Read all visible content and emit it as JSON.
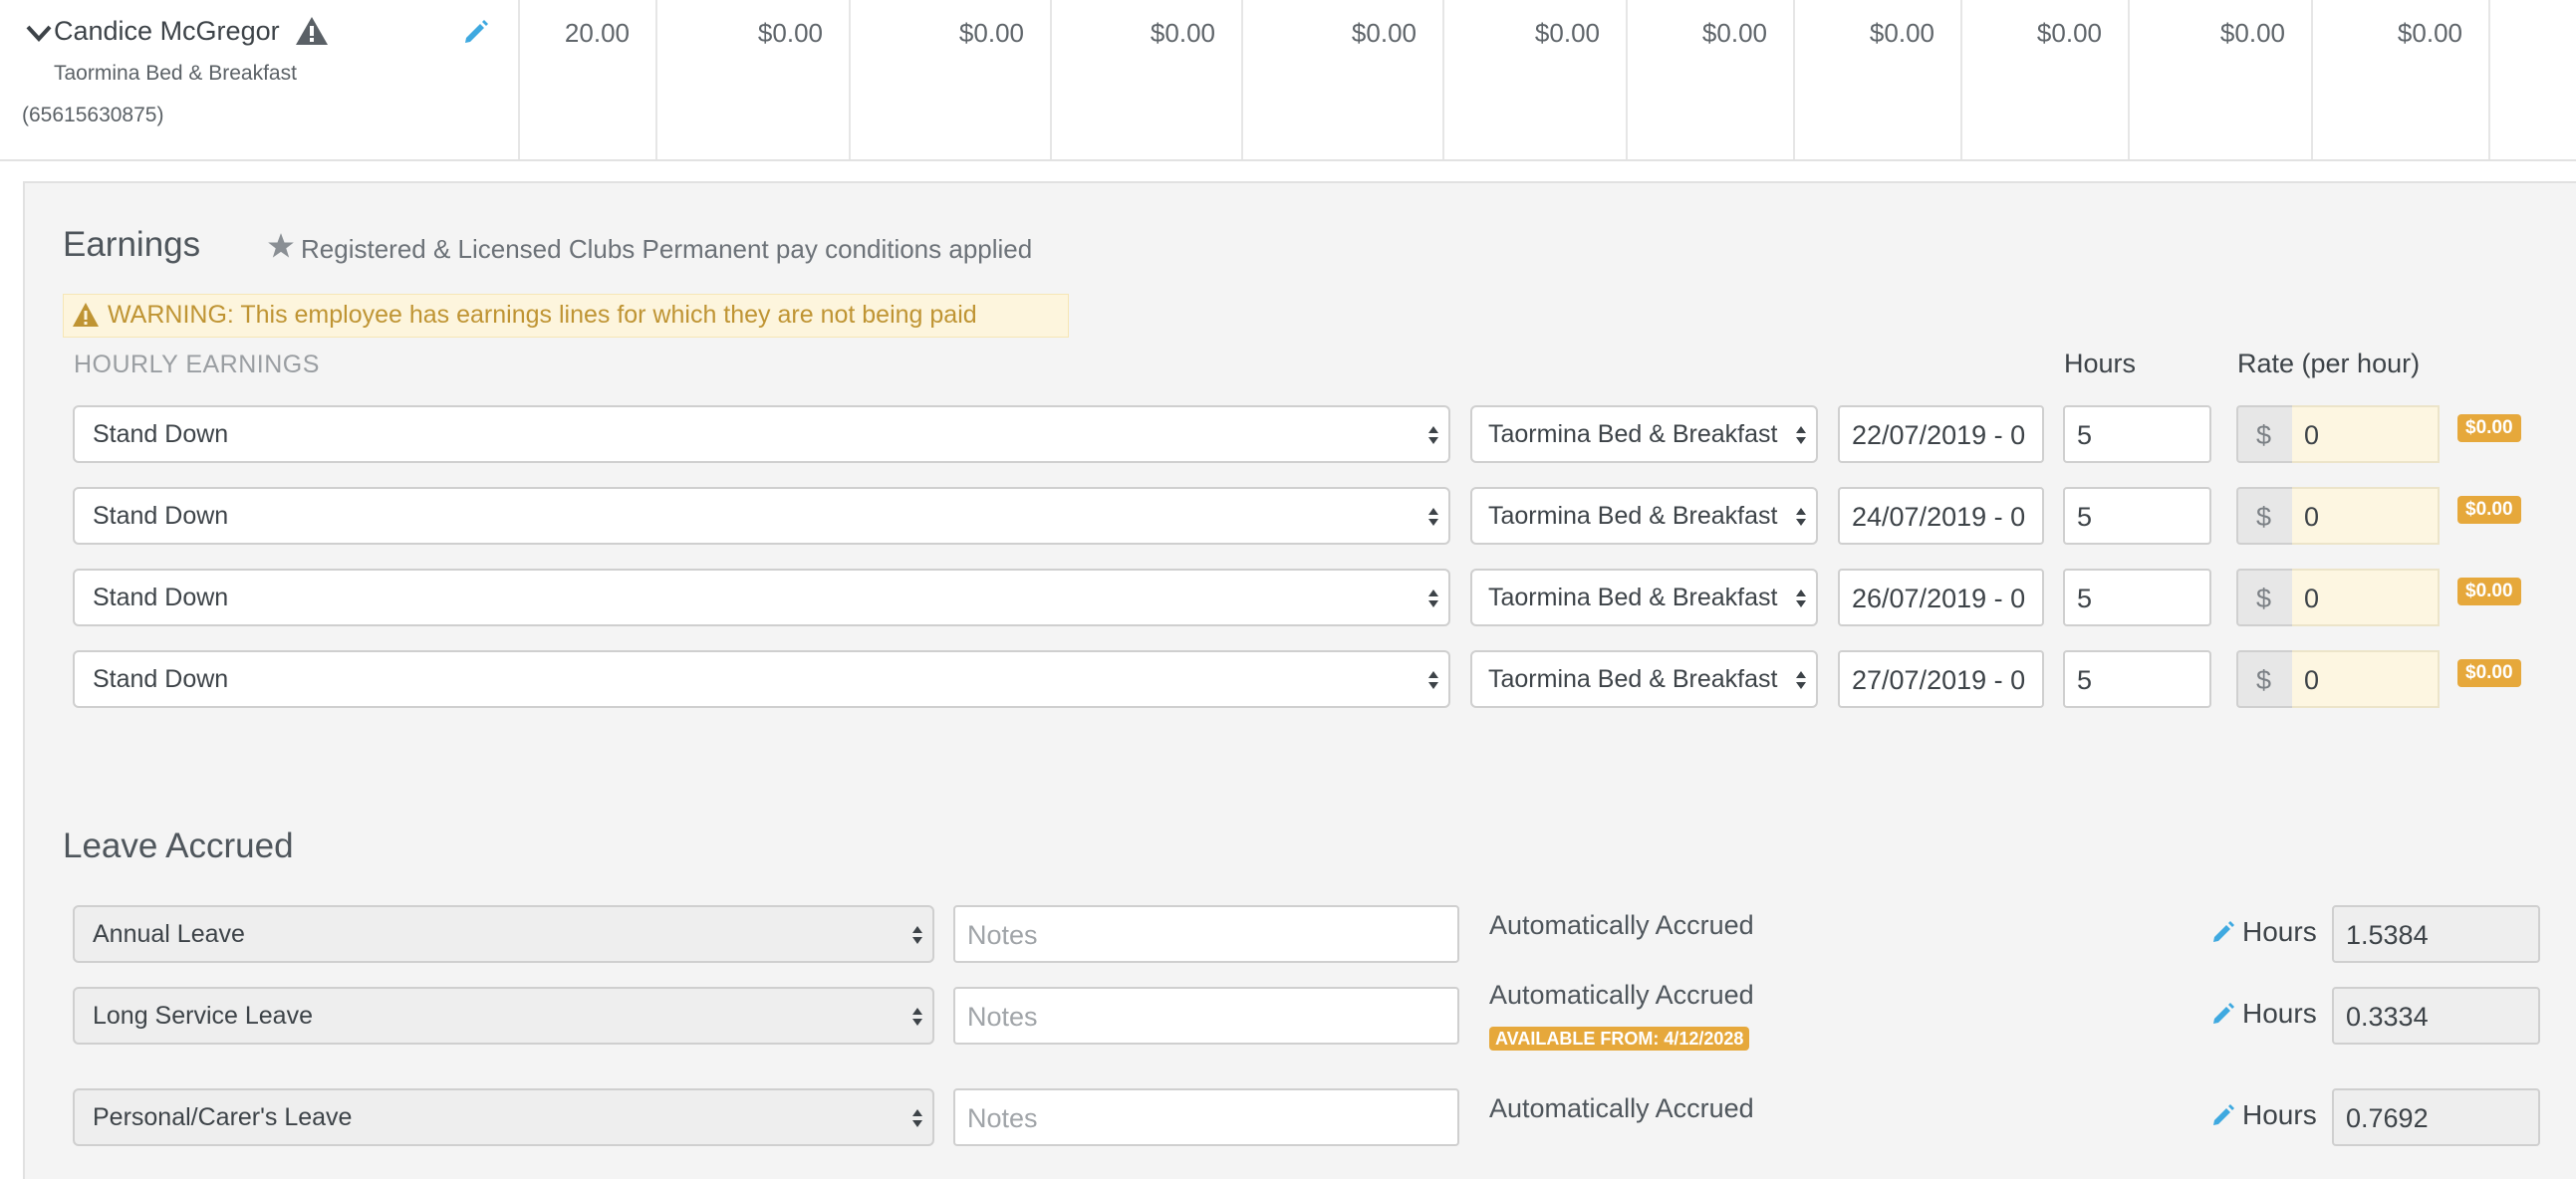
{
  "employee": {
    "name": "Candice McGregor",
    "company": "Taormina Bed & Breakfast",
    "id": "(65615630875)",
    "cells": [
      "20.00",
      "$0.00",
      "$0.00",
      "$0.00",
      "$0.00",
      "$0.00",
      "$0.00",
      "$0.00",
      "$0.00",
      "$0.00",
      "$0.00"
    ]
  },
  "earnings": {
    "title": "Earnings",
    "pay_conditions": "Registered & Licensed Clubs Permanent pay conditions applied",
    "warning": "WARNING: This employee has earnings lines for which they are not being paid",
    "hourly_label": "HOURLY EARNINGS",
    "col_hours": "Hours",
    "col_rate": "Rate (per hour)",
    "currency_symbol": "$",
    "rows": [
      {
        "category": "Stand Down",
        "location": "Taormina Bed & Breakfast",
        "date": "22/07/2019 - 0",
        "hours": "5",
        "rate": "0",
        "total": "$0.00"
      },
      {
        "category": "Stand Down",
        "location": "Taormina Bed & Breakfast",
        "date": "24/07/2019 - 0",
        "hours": "5",
        "rate": "0",
        "total": "$0.00"
      },
      {
        "category": "Stand Down",
        "location": "Taormina Bed & Breakfast",
        "date": "26/07/2019 - 0",
        "hours": "5",
        "rate": "0",
        "total": "$0.00"
      },
      {
        "category": "Stand Down",
        "location": "Taormina Bed & Breakfast",
        "date": "27/07/2019 - 0",
        "hours": "5",
        "rate": "0",
        "total": "$0.00"
      }
    ]
  },
  "leave": {
    "title": "Leave Accrued",
    "notes_placeholder": "Notes",
    "hours_label": "Hours",
    "rows": [
      {
        "type": "Annual Leave",
        "status": "Automatically Accrued",
        "badge": "",
        "hours": "1.5384"
      },
      {
        "type": "Long Service Leave",
        "status": "Automatically Accrued",
        "badge": "AVAILABLE FROM: 4/12/2028",
        "hours": "0.3334"
      },
      {
        "type": "Personal/Carer's Leave",
        "status": "Automatically Accrued",
        "badge": "",
        "hours": "0.7692"
      }
    ]
  },
  "colors": {
    "accent_blue": "#3fa9e0",
    "badge_orange": "#e6a83b",
    "warning_text": "#bf9433"
  }
}
